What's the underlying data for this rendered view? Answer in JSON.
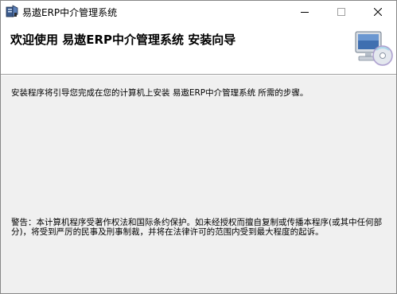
{
  "window": {
    "title": "易遨ERP中介管理系统",
    "controls": {
      "minimize_icon": "minimize-icon",
      "maximize_icon": "maximize-icon",
      "close_icon": "close-icon"
    }
  },
  "banner": {
    "title": "欢迎使用 易遨ERP中介管理系统 安装向导",
    "graphic": "computer-cd-icon"
  },
  "content": {
    "intro": "安装程序将引导您完成在您的计算机上安装 易遨ERP中介管理系统 所需的步骤。",
    "warning": "警告：本计算机程序受著作权法和国际条约保护。如未经授权而擅自复制或传播本程序(或其中任何部分)，将受到严厉的民事及刑事制裁，并将在法律许可的范围内受到最大程度的起诉。"
  },
  "colors": {
    "background": "#f0f0f0",
    "banner": "#ffffff"
  }
}
